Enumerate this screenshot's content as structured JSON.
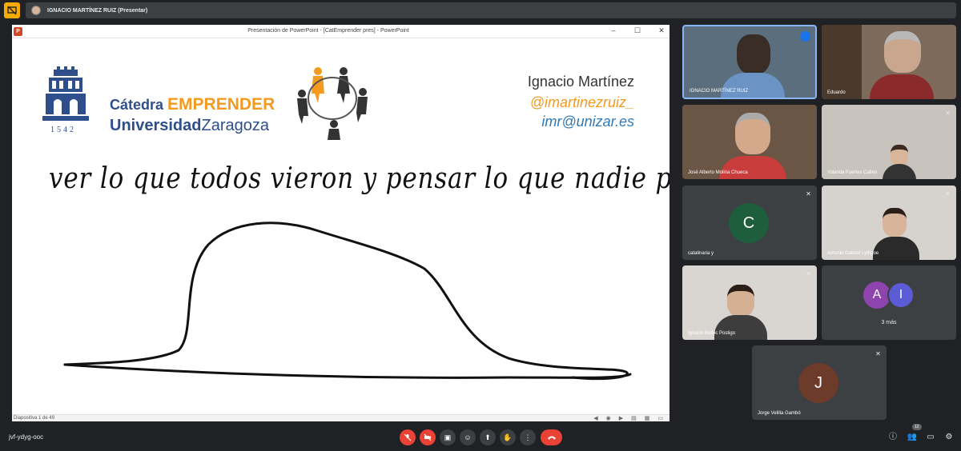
{
  "presenter_bar": {
    "label": "IGNACIO MARTÍNEZ RUIZ (Presentar)"
  },
  "ppt": {
    "window_title": "Presentación de PowerPoint - [CatEmprender pres] - PowerPoint",
    "status": "Diapositiva 1 de 49"
  },
  "slide": {
    "crest_year": "1542",
    "catedra_prefix": "Cátedra",
    "catedra_emph": "EMPRENDER",
    "univ_bold": "Universidad",
    "univ_rest": "Zaragoza",
    "author_name": "Ignacio Martínez",
    "author_handle": "@imartinezruiz_",
    "author_mail": "imr@unizar.es",
    "quote": "ver lo que todos vieron y pensar lo que nadie pensó"
  },
  "participants": [
    {
      "name": "IGNACIO MARTÍNEZ RUIZ"
    },
    {
      "name": "Eduardo"
    },
    {
      "name": "José Alberto Molina Chueca"
    },
    {
      "name": "Yolanda Fuertes Callén"
    },
    {
      "name": "catalinaria y",
      "initial": "C",
      "color": "#1e5e3c"
    },
    {
      "name": "Antonio Gabriel Lythgoe"
    },
    {
      "name": "Ignacio Belloc Postigo"
    },
    {
      "initial_a": "A",
      "initial_b": "I",
      "color_a": "#8e44ad",
      "color_b": "#5b5bd6",
      "more": "3 más"
    },
    {
      "name": "Jorge Velilla Gambó",
      "initial": "J",
      "color": "#6d3b2a"
    }
  ],
  "bottom": {
    "meeting_code": "jvf-ydyg-ooc",
    "participant_count": "12"
  },
  "icons": {
    "mic": "mic-off-icon",
    "cam": "camera-off-icon",
    "captions": "captions-icon",
    "emoji": "emoji-icon",
    "present": "present-icon",
    "hand": "raise-hand-icon",
    "more": "more-vert-icon",
    "leave": "call-end-icon"
  }
}
